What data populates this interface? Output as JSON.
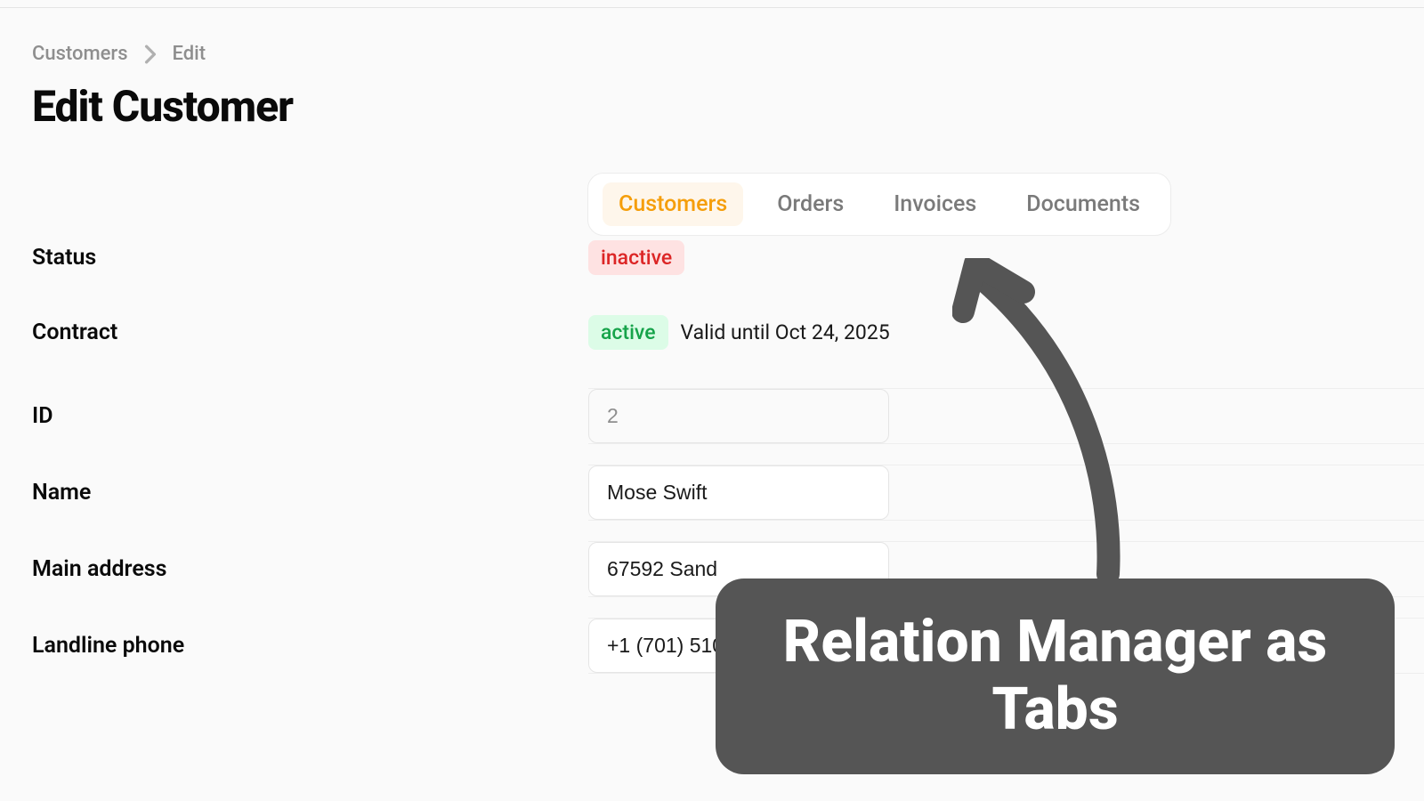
{
  "breadcrumb": {
    "root": "Customers",
    "current": "Edit"
  },
  "page": {
    "title": "Edit Customer"
  },
  "tabs": {
    "items": [
      {
        "label": "Customers",
        "active": true
      },
      {
        "label": "Orders",
        "active": false
      },
      {
        "label": "Invoices",
        "active": false
      },
      {
        "label": "Documents",
        "active": false
      }
    ]
  },
  "form": {
    "status": {
      "label": "Status",
      "badge": "inactive",
      "badge_color": "#dc2626",
      "badge_bg": "#fee2e2"
    },
    "contract": {
      "label": "Contract",
      "badge": "active",
      "badge_color": "#16a34a",
      "badge_bg": "#dcfce7",
      "note": "Valid until Oct 24, 2025"
    },
    "id": {
      "label": "ID",
      "value": "2"
    },
    "name": {
      "label": "Name",
      "value": "Mose Swift"
    },
    "main_address": {
      "label": "Main address",
      "value": "67592 Sand"
    },
    "landline": {
      "label": "Landline phone",
      "value": "+1 (701) 510"
    }
  },
  "annotation": {
    "text": "Relation Manager as Tabs"
  }
}
